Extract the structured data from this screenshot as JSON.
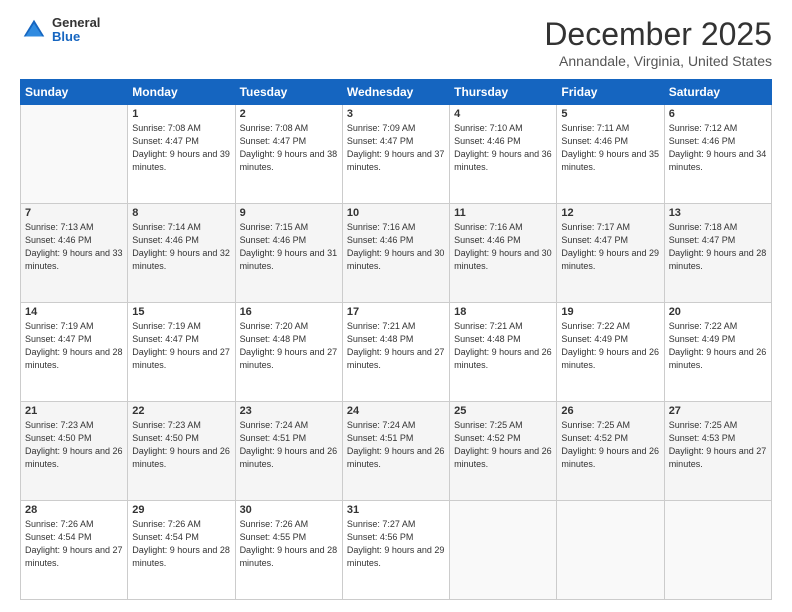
{
  "header": {
    "logo_general": "General",
    "logo_blue": "Blue",
    "month_title": "December 2025",
    "subtitle": "Annandale, Virginia, United States"
  },
  "days_of_week": [
    "Sunday",
    "Monday",
    "Tuesday",
    "Wednesday",
    "Thursday",
    "Friday",
    "Saturday"
  ],
  "weeks": [
    [
      {
        "day": "",
        "sunrise": "",
        "sunset": "",
        "daylight": ""
      },
      {
        "day": "1",
        "sunrise": "Sunrise: 7:08 AM",
        "sunset": "Sunset: 4:47 PM",
        "daylight": "Daylight: 9 hours and 39 minutes."
      },
      {
        "day": "2",
        "sunrise": "Sunrise: 7:08 AM",
        "sunset": "Sunset: 4:47 PM",
        "daylight": "Daylight: 9 hours and 38 minutes."
      },
      {
        "day": "3",
        "sunrise": "Sunrise: 7:09 AM",
        "sunset": "Sunset: 4:47 PM",
        "daylight": "Daylight: 9 hours and 37 minutes."
      },
      {
        "day": "4",
        "sunrise": "Sunrise: 7:10 AM",
        "sunset": "Sunset: 4:46 PM",
        "daylight": "Daylight: 9 hours and 36 minutes."
      },
      {
        "day": "5",
        "sunrise": "Sunrise: 7:11 AM",
        "sunset": "Sunset: 4:46 PM",
        "daylight": "Daylight: 9 hours and 35 minutes."
      },
      {
        "day": "6",
        "sunrise": "Sunrise: 7:12 AM",
        "sunset": "Sunset: 4:46 PM",
        "daylight": "Daylight: 9 hours and 34 minutes."
      }
    ],
    [
      {
        "day": "7",
        "sunrise": "Sunrise: 7:13 AM",
        "sunset": "Sunset: 4:46 PM",
        "daylight": "Daylight: 9 hours and 33 minutes."
      },
      {
        "day": "8",
        "sunrise": "Sunrise: 7:14 AM",
        "sunset": "Sunset: 4:46 PM",
        "daylight": "Daylight: 9 hours and 32 minutes."
      },
      {
        "day": "9",
        "sunrise": "Sunrise: 7:15 AM",
        "sunset": "Sunset: 4:46 PM",
        "daylight": "Daylight: 9 hours and 31 minutes."
      },
      {
        "day": "10",
        "sunrise": "Sunrise: 7:16 AM",
        "sunset": "Sunset: 4:46 PM",
        "daylight": "Daylight: 9 hours and 30 minutes."
      },
      {
        "day": "11",
        "sunrise": "Sunrise: 7:16 AM",
        "sunset": "Sunset: 4:46 PM",
        "daylight": "Daylight: 9 hours and 30 minutes."
      },
      {
        "day": "12",
        "sunrise": "Sunrise: 7:17 AM",
        "sunset": "Sunset: 4:47 PM",
        "daylight": "Daylight: 9 hours and 29 minutes."
      },
      {
        "day": "13",
        "sunrise": "Sunrise: 7:18 AM",
        "sunset": "Sunset: 4:47 PM",
        "daylight": "Daylight: 9 hours and 28 minutes."
      }
    ],
    [
      {
        "day": "14",
        "sunrise": "Sunrise: 7:19 AM",
        "sunset": "Sunset: 4:47 PM",
        "daylight": "Daylight: 9 hours and 28 minutes."
      },
      {
        "day": "15",
        "sunrise": "Sunrise: 7:19 AM",
        "sunset": "Sunset: 4:47 PM",
        "daylight": "Daylight: 9 hours and 27 minutes."
      },
      {
        "day": "16",
        "sunrise": "Sunrise: 7:20 AM",
        "sunset": "Sunset: 4:48 PM",
        "daylight": "Daylight: 9 hours and 27 minutes."
      },
      {
        "day": "17",
        "sunrise": "Sunrise: 7:21 AM",
        "sunset": "Sunset: 4:48 PM",
        "daylight": "Daylight: 9 hours and 27 minutes."
      },
      {
        "day": "18",
        "sunrise": "Sunrise: 7:21 AM",
        "sunset": "Sunset: 4:48 PM",
        "daylight": "Daylight: 9 hours and 26 minutes."
      },
      {
        "day": "19",
        "sunrise": "Sunrise: 7:22 AM",
        "sunset": "Sunset: 4:49 PM",
        "daylight": "Daylight: 9 hours and 26 minutes."
      },
      {
        "day": "20",
        "sunrise": "Sunrise: 7:22 AM",
        "sunset": "Sunset: 4:49 PM",
        "daylight": "Daylight: 9 hours and 26 minutes."
      }
    ],
    [
      {
        "day": "21",
        "sunrise": "Sunrise: 7:23 AM",
        "sunset": "Sunset: 4:50 PM",
        "daylight": "Daylight: 9 hours and 26 minutes."
      },
      {
        "day": "22",
        "sunrise": "Sunrise: 7:23 AM",
        "sunset": "Sunset: 4:50 PM",
        "daylight": "Daylight: 9 hours and 26 minutes."
      },
      {
        "day": "23",
        "sunrise": "Sunrise: 7:24 AM",
        "sunset": "Sunset: 4:51 PM",
        "daylight": "Daylight: 9 hours and 26 minutes."
      },
      {
        "day": "24",
        "sunrise": "Sunrise: 7:24 AM",
        "sunset": "Sunset: 4:51 PM",
        "daylight": "Daylight: 9 hours and 26 minutes."
      },
      {
        "day": "25",
        "sunrise": "Sunrise: 7:25 AM",
        "sunset": "Sunset: 4:52 PM",
        "daylight": "Daylight: 9 hours and 26 minutes."
      },
      {
        "day": "26",
        "sunrise": "Sunrise: 7:25 AM",
        "sunset": "Sunset: 4:52 PM",
        "daylight": "Daylight: 9 hours and 26 minutes."
      },
      {
        "day": "27",
        "sunrise": "Sunrise: 7:25 AM",
        "sunset": "Sunset: 4:53 PM",
        "daylight": "Daylight: 9 hours and 27 minutes."
      }
    ],
    [
      {
        "day": "28",
        "sunrise": "Sunrise: 7:26 AM",
        "sunset": "Sunset: 4:54 PM",
        "daylight": "Daylight: 9 hours and 27 minutes."
      },
      {
        "day": "29",
        "sunrise": "Sunrise: 7:26 AM",
        "sunset": "Sunset: 4:54 PM",
        "daylight": "Daylight: 9 hours and 28 minutes."
      },
      {
        "day": "30",
        "sunrise": "Sunrise: 7:26 AM",
        "sunset": "Sunset: 4:55 PM",
        "daylight": "Daylight: 9 hours and 28 minutes."
      },
      {
        "day": "31",
        "sunrise": "Sunrise: 7:27 AM",
        "sunset": "Sunset: 4:56 PM",
        "daylight": "Daylight: 9 hours and 29 minutes."
      },
      {
        "day": "",
        "sunrise": "",
        "sunset": "",
        "daylight": ""
      },
      {
        "day": "",
        "sunrise": "",
        "sunset": "",
        "daylight": ""
      },
      {
        "day": "",
        "sunrise": "",
        "sunset": "",
        "daylight": ""
      }
    ]
  ]
}
